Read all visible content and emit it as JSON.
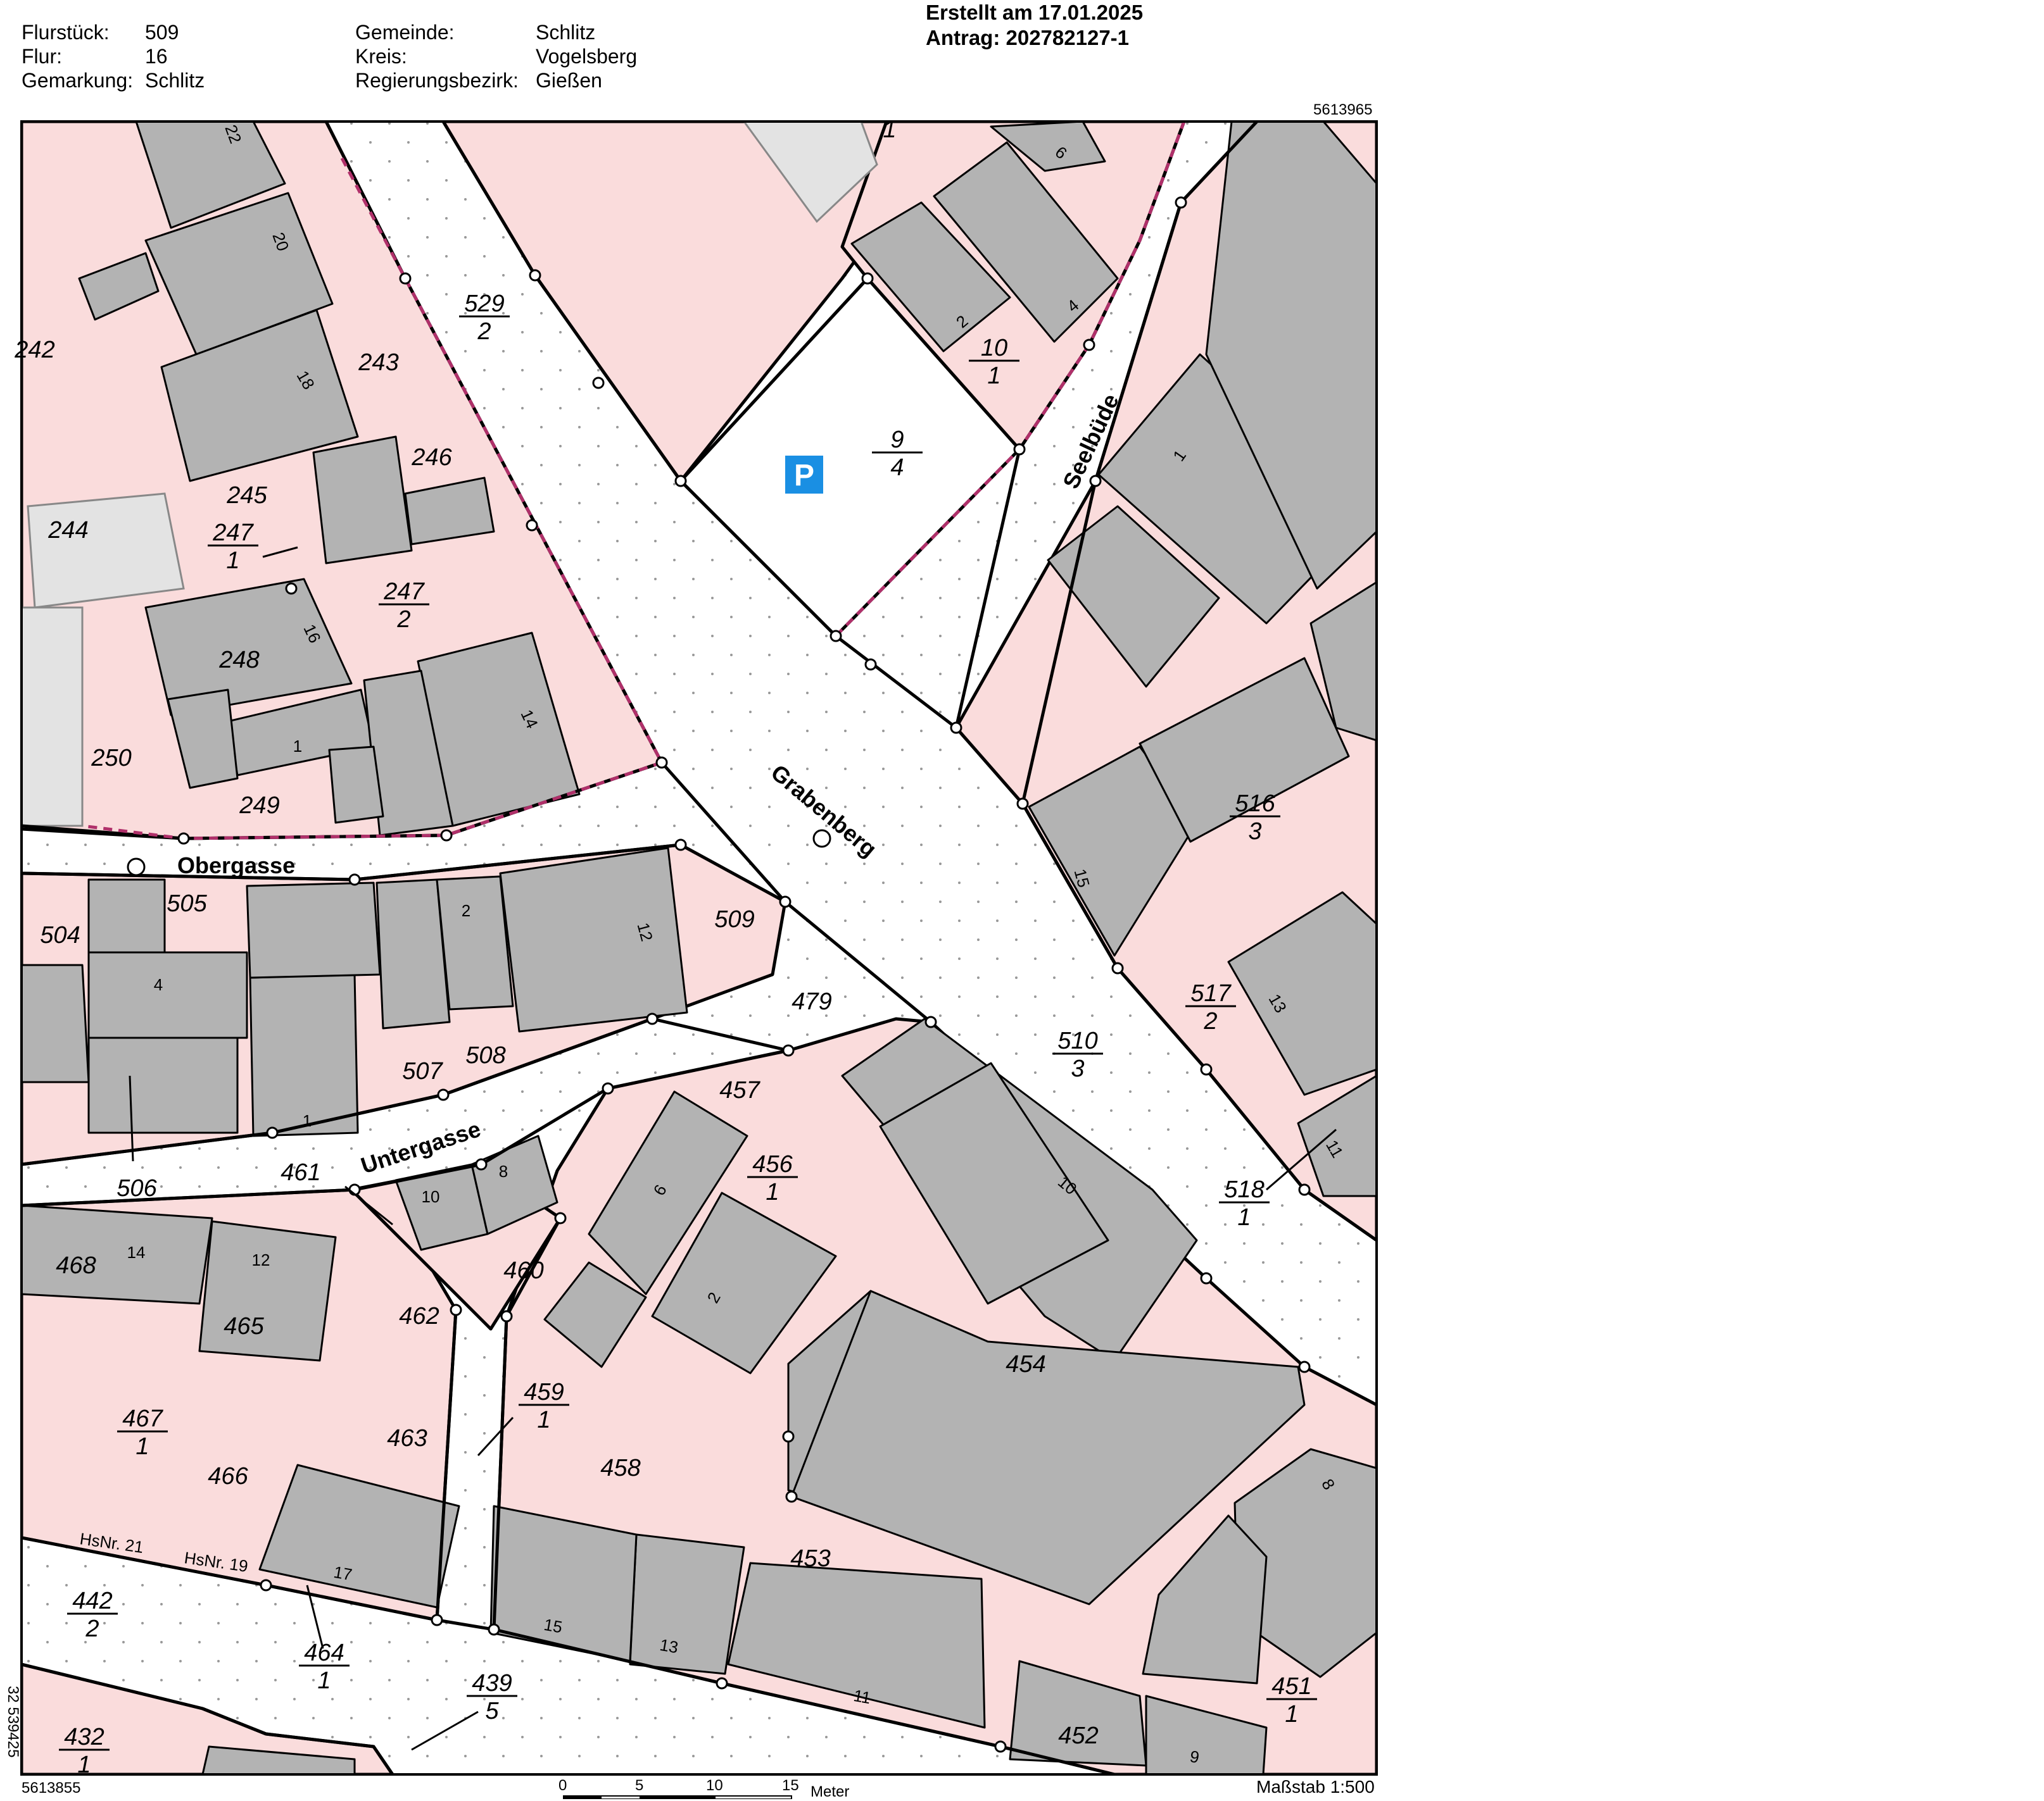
{
  "header": {
    "left": [
      {
        "label": "Flurstück:",
        "value": "509"
      },
      {
        "label": "Flur:",
        "value": "16"
      },
      {
        "label": "Gemarkung:",
        "value": "Schlitz"
      }
    ],
    "middle": [
      {
        "label": "Gemeinde:",
        "value": "Schlitz"
      },
      {
        "label": "Kreis:",
        "value": "Vogelsberg"
      },
      {
        "label": "Regierungsbezirk:",
        "value": "Gießen"
      }
    ],
    "created": "Erstellt am 17.01.2025",
    "request": "Antrag: 202782127-1"
  },
  "coords": {
    "top_right": "5613965",
    "bottom_left": "5613855",
    "left_vertical": "32 539425"
  },
  "streets": {
    "obergasse": "Obergasse",
    "untergasse": "Untergasse",
    "grabenberg": "Grabenberg",
    "seelbuede": "Seelbüde"
  },
  "parking_symbol": "P",
  "parcels": [
    {
      "id": "p529",
      "num": "529",
      "den": "2"
    },
    {
      "id": "p243",
      "num": "243"
    },
    {
      "id": "p242",
      "num": "242"
    },
    {
      "id": "p246",
      "num": "246"
    },
    {
      "id": "p245",
      "num": "245"
    },
    {
      "id": "p244",
      "num": "244"
    },
    {
      "id": "p247-1",
      "num": "247",
      "den": "1"
    },
    {
      "id": "p247-2",
      "num": "247",
      "den": "2"
    },
    {
      "id": "p248",
      "num": "248"
    },
    {
      "id": "p250",
      "num": "250"
    },
    {
      "id": "p249",
      "num": "249"
    },
    {
      "id": "p9-4",
      "num": "9",
      "den": "4"
    },
    {
      "id": "p10-1",
      "num": "10",
      "den": "1"
    },
    {
      "id": "p1top",
      "num": "1"
    },
    {
      "id": "p505",
      "num": "505"
    },
    {
      "id": "p504",
      "num": "504"
    },
    {
      "id": "p509",
      "num": "509"
    },
    {
      "id": "p479",
      "num": "479"
    },
    {
      "id": "p507",
      "num": "507"
    },
    {
      "id": "p508",
      "num": "508"
    },
    {
      "id": "p506",
      "num": "506"
    },
    {
      "id": "p516-3",
      "num": "516",
      "den": "3"
    },
    {
      "id": "p517-2",
      "num": "517",
      "den": "2"
    },
    {
      "id": "p510-3",
      "num": "510",
      "den": "3"
    },
    {
      "id": "p518-1",
      "num": "518",
      "den": "1"
    },
    {
      "id": "p457",
      "num": "457"
    },
    {
      "id": "p456-1",
      "num": "456",
      "den": "1"
    },
    {
      "id": "p461",
      "num": "461"
    },
    {
      "id": "p460",
      "num": "460"
    },
    {
      "id": "p462",
      "num": "462"
    },
    {
      "id": "p468",
      "num": "468"
    },
    {
      "id": "p465",
      "num": "465"
    },
    {
      "id": "p467-1",
      "num": "467",
      "den": "1"
    },
    {
      "id": "p466",
      "num": "466"
    },
    {
      "id": "p463",
      "num": "463"
    },
    {
      "id": "p459-1",
      "num": "459",
      "den": "1"
    },
    {
      "id": "p458",
      "num": "458"
    },
    {
      "id": "p454",
      "num": "454"
    },
    {
      "id": "p453",
      "num": "453"
    },
    {
      "id": "p452",
      "num": "452"
    },
    {
      "id": "p451-1",
      "num": "451",
      "den": "1"
    },
    {
      "id": "p442-2",
      "num": "442",
      "den": "2"
    },
    {
      "id": "p464-1",
      "num": "464",
      "den": "1"
    },
    {
      "id": "p439-5",
      "num": "439",
      "den": "5"
    },
    {
      "id": "p432-1",
      "num": "432",
      "den": "1"
    }
  ],
  "house_numbers": [
    "22",
    "20",
    "18",
    "16",
    "14",
    "1",
    "6",
    "2",
    "4",
    "1",
    "4",
    "2",
    "12",
    "1",
    "15",
    "13",
    "11",
    "10",
    "6",
    "2",
    "10",
    "8",
    "14",
    "12",
    "17",
    "15",
    "13",
    "11",
    "9",
    "8"
  ],
  "hs_labels": {
    "hs21": "HsNr. 21",
    "hs19": "HsNr. 19"
  },
  "scale": {
    "ticks": [
      "0",
      "5",
      "10",
      "15"
    ],
    "unit": "Meter",
    "ratio": "Maßstab 1:500"
  },
  "colors": {
    "parcel_fill": "#fadcdc",
    "building_fill": "#b3b3b3",
    "light_building": "#e3e3e3",
    "boundary": "#000000",
    "district_boundary": "#b0306a",
    "parking": "#1a8fe3"
  }
}
